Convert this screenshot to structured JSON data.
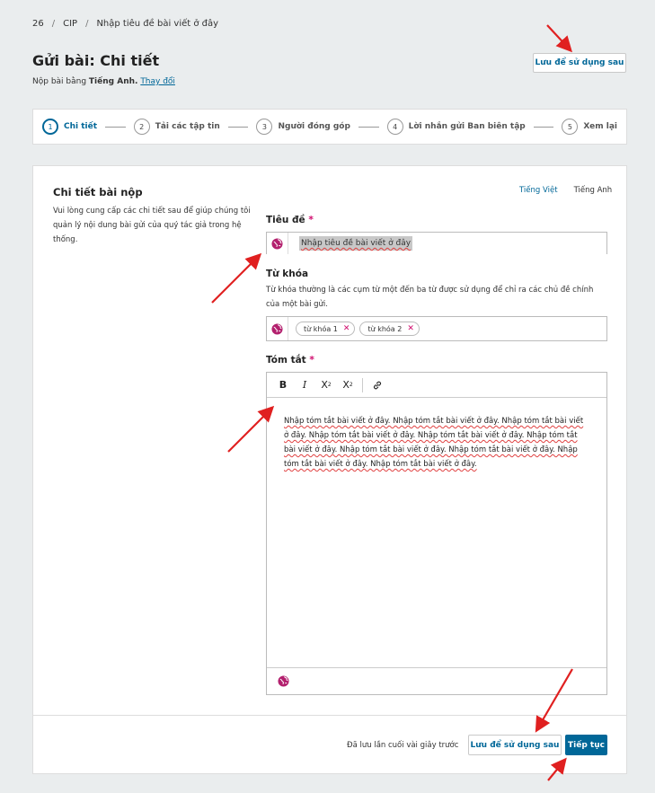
{
  "breadcrumb": [
    "26",
    "CIP",
    "Nhập tiêu đề bài viết ở đây"
  ],
  "page": {
    "title": "Gửi bài: Chi tiết",
    "lang_prefix": "Nộp bài bằng ",
    "lang_name": "Tiếng Anh.",
    "lang_change": "Thay đổi",
    "save_later": "Lưu để sử dụng sau"
  },
  "steps": [
    {
      "num": "1",
      "label": "Chi tiết"
    },
    {
      "num": "2",
      "label": "Tải các tập tin"
    },
    {
      "num": "3",
      "label": "Người đóng góp"
    },
    {
      "num": "4",
      "label": "Lời nhắn gửi Ban biên tập"
    },
    {
      "num": "5",
      "label": "Xem lại"
    }
  ],
  "section": {
    "title": "Chi tiết bài nộp",
    "description": "Vui lòng cung cấp các chi tiết sau để giúp chúng tôi quản lý nội dung bài gửi của quý tác giả trong hệ thống.",
    "lang_tabs": [
      "Tiếng Việt",
      "Tiếng Anh"
    ]
  },
  "fields": {
    "title_label": "Tiêu đề",
    "required_mark": "*",
    "title_value": "Nhập tiêu đề bài viết ở đây",
    "keywords_label": "Từ khóa",
    "keywords_desc": "Từ khóa thường là các cụm từ một đến ba từ được sử dụng để chỉ ra các chủ đề chính của một bài gửi.",
    "keywords": [
      "từ khóa 1",
      "từ khóa 2"
    ],
    "abstract_label": "Tóm tắt",
    "abstract_text": "Nhập tóm tắt bài viết ở đây. Nhập tóm tắt bài viết ở đây. Nhập tóm tắt bài viết ở đây. Nhập tóm tắt bài viết ở đây. Nhập tóm tắt bài viết ở đây. Nhập tóm tắt bài viết ở đây. Nhập tóm tắt bài viết ở đây. Nhập tóm tắt bài viết ở đây. Nhập tóm tắt bài viết ở đây. Nhập tóm tắt bài viết ở đây."
  },
  "toolbar": {
    "bold": "B",
    "italic": "I",
    "sup": "X",
    "sub": "X",
    "sup_mark": "2",
    "sub_mark": "2"
  },
  "footer": {
    "saved_msg": "Đã lưu lần cuối vài giây trước",
    "save_later": "Lưu để sử dụng sau",
    "next": "Tiếp tục"
  },
  "colors": {
    "accent": "#006798",
    "required": "#d00a6c",
    "annotation_arrow": "#e02020"
  }
}
